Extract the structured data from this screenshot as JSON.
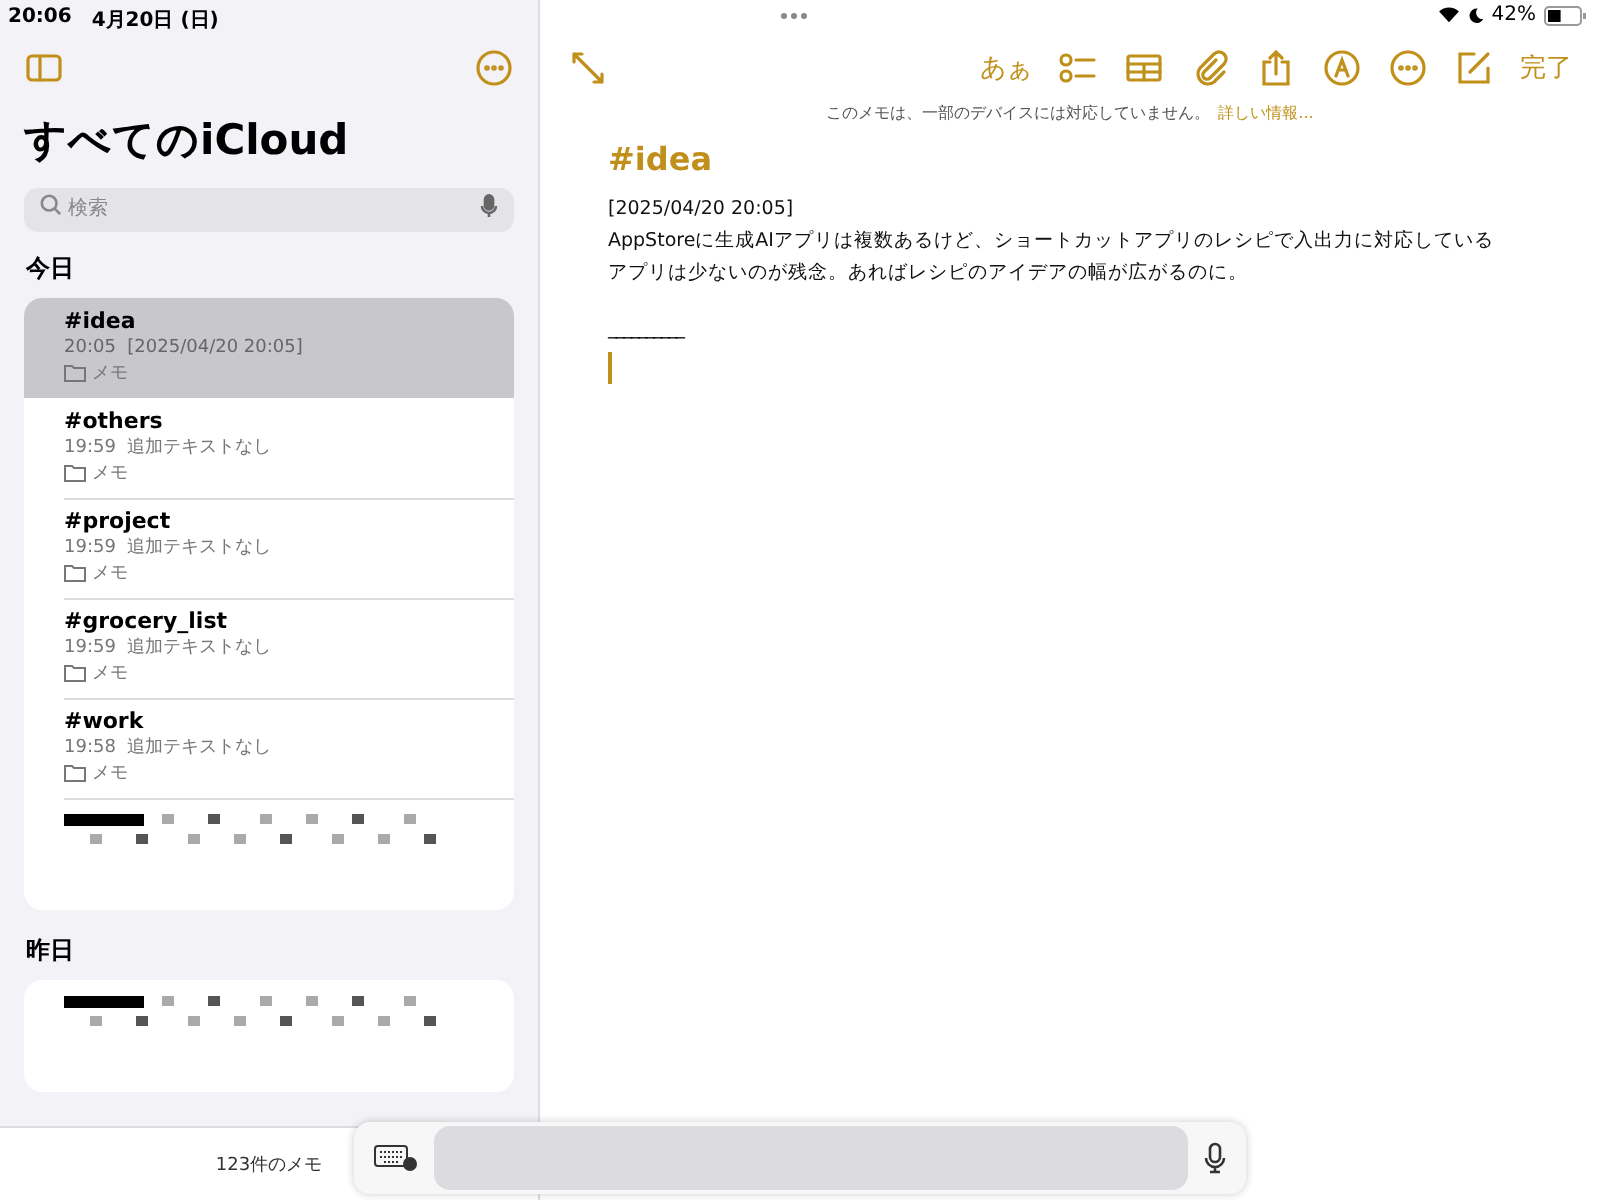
{
  "status_bar": {
    "time": "20:06",
    "date": "4月20日 (日)",
    "battery": "42%"
  },
  "sidebar": {
    "title": "すべてのiCloud",
    "search": {
      "placeholder": "検索"
    },
    "sections": [
      {
        "heading": "今日",
        "notes": [
          {
            "kind": "note",
            "title": "#idea",
            "time": "20:05",
            "preview": "[2025/04/20 20:05]",
            "folder": "メモ",
            "selected": true
          },
          {
            "kind": "note",
            "title": "#others",
            "time": "19:59",
            "preview": "追加テキストなし",
            "folder": "メモ",
            "selected": false
          },
          {
            "kind": "note",
            "title": "#project",
            "time": "19:59",
            "preview": "追加テキストなし",
            "folder": "メモ",
            "selected": false
          },
          {
            "kind": "note",
            "title": "#grocery_list",
            "time": "19:59",
            "preview": "追加テキストなし",
            "folder": "メモ",
            "selected": false
          },
          {
            "kind": "note",
            "title": "#work",
            "time": "19:58",
            "preview": "追加テキストなし",
            "folder": "メモ",
            "selected": false
          },
          {
            "kind": "redacted"
          }
        ]
      },
      {
        "heading": "昨日",
        "notes": [
          {
            "kind": "redacted"
          }
        ]
      }
    ],
    "footer": "123件のメモ"
  },
  "editor": {
    "text_style": "あぁ",
    "done": "完了",
    "notice": "このメモは、一部のデバイスには対応していません。",
    "notice_link": "詳しい情報...",
    "title": "#idea",
    "lines": [
      "[2025/04/20 20:05]",
      "AppStoreに生成AIアプリは複数あるけど、ショートカットアプリのレシピで入出力に対応している",
      "アプリは少ないのが残念。あればレシピのアイデアの幅が広がるのに。"
    ],
    "separator": "__________"
  }
}
